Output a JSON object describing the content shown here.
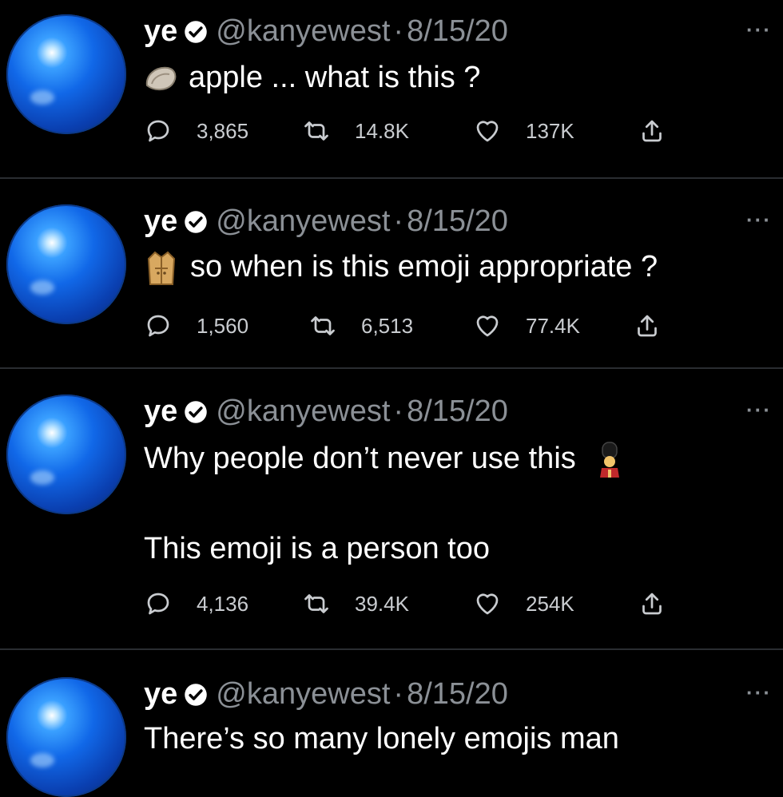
{
  "tweets": [
    {
      "name": "ye",
      "handle": "@kanyewest",
      "sep": "·",
      "date": "8/15/20",
      "more": "···",
      "text_lines": [
        "apple ... what is this ?"
      ],
      "emoji": "oyster-emoji",
      "replies": "3,865",
      "retweets": "14.8K",
      "likes": "137K"
    },
    {
      "name": "ye",
      "handle": "@kanyewest",
      "sep": "·",
      "date": "8/15/20",
      "more": "···",
      "text_lines": [
        "so when is this emoji appropriate ?"
      ],
      "emoji": "trench-coat-emoji",
      "replies": "1,560",
      "retweets": "6,513",
      "likes": "77.4K"
    },
    {
      "name": "ye",
      "handle": "@kanyewest",
      "sep": "·",
      "date": "8/15/20",
      "more": "···",
      "text_lines": [
        "Why people don’t never use this",
        "This emoji is a person too"
      ],
      "emoji": "guard-emoji",
      "replies": "4,136",
      "retweets": "39.4K",
      "likes": "254K"
    },
    {
      "name": "ye",
      "handle": "@kanyewest",
      "sep": "·",
      "date": "8/15/20",
      "more": "···",
      "text_lines": [
        "There’s so many lonely emojis man"
      ]
    }
  ],
  "colors": {
    "background": "#000000",
    "text": "#ffffff",
    "muted": "#8b9096",
    "divider": "#2a2d31",
    "avatar_blue": "#1168e8"
  }
}
